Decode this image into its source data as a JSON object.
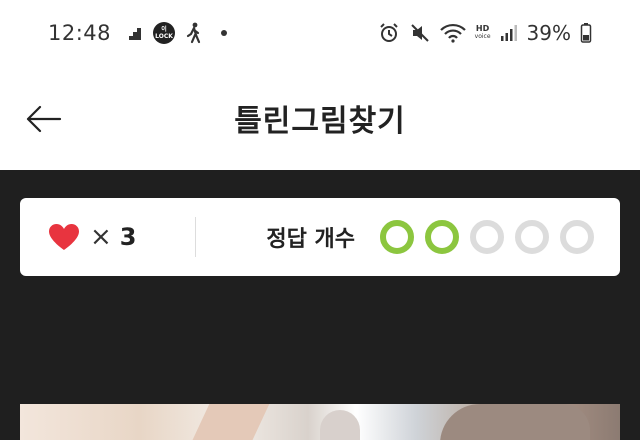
{
  "status_bar": {
    "time": "12:48",
    "olock_top": "이",
    "olock_bottom": "LOCK",
    "hd_top": "HD",
    "hd_bottom": "voice",
    "battery": "39%"
  },
  "header": {
    "title": "틀린그림찾기"
  },
  "game": {
    "lives_times": "×",
    "lives_count": "3",
    "answers_label": "정답 개수",
    "answers_found": 2,
    "answers_total": 5
  },
  "colors": {
    "heart": "#e8343f",
    "answer_done": "#8cc63f",
    "answer_pending": "#dcdcdc",
    "background": "#1f1f1f"
  },
  "icons": [
    "back-arrow-icon",
    "heart-icon",
    "alarm-icon",
    "mute-icon",
    "wifi-icon",
    "signal-icon",
    "battery-icon",
    "walk-icon",
    "steps-icon"
  ]
}
